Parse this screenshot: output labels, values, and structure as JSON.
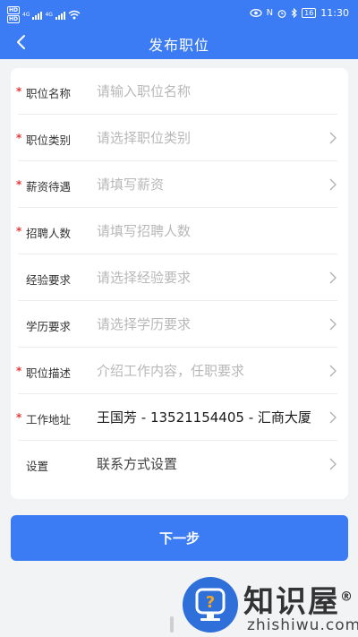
{
  "status_bar": {
    "hd1": "HD",
    "hd2": "HD",
    "net1": "4G",
    "net2": "4G",
    "nfc": "N",
    "battery": "16",
    "time": "11:30"
  },
  "header": {
    "title": "发布职位"
  },
  "form": {
    "fields": [
      {
        "label": "职位名称",
        "value": "请输入职位名称",
        "required": "*"
      },
      {
        "label": "职位类别",
        "value": "请选择职位类别",
        "required": "*"
      },
      {
        "label": "薪资待遇",
        "value": "请填写薪资",
        "required": "*"
      },
      {
        "label": "招聘人数",
        "value": "请填写招聘人数",
        "required": "*"
      },
      {
        "label": "经验要求",
        "value": "请选择经验要求",
        "required": ""
      },
      {
        "label": "学历要求",
        "value": "请选择学历要求",
        "required": ""
      },
      {
        "label": "职位描述",
        "value": "介绍工作内容，任职要求",
        "required": "*"
      },
      {
        "label": "工作地址",
        "value": "王国芳 - 13521154405 - 汇商大厦",
        "required": "*"
      },
      {
        "label": "设置",
        "value": "联系方式设置",
        "required": ""
      }
    ]
  },
  "actions": {
    "next_label": "下一步"
  },
  "watermark": {
    "cn": "知识屋",
    "en": "zhishiwu.com",
    "mark": "®"
  },
  "colors": {
    "primary": "#3b7cf5",
    "required": "#e23c3c",
    "placeholder": "#b8b8b8"
  }
}
